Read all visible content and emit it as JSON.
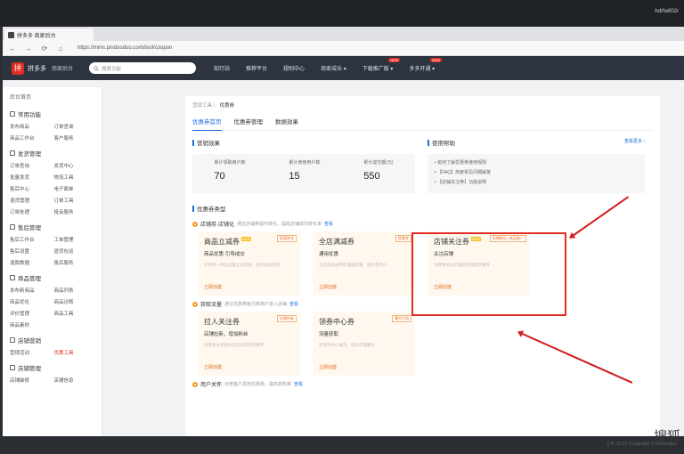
{
  "os": {
    "user_text": "hdrfw802r"
  },
  "browser": {
    "tab_title": "拼多多 商家后台",
    "url": "https://mms.pinduoduo.com/tool/coupon",
    "nav": [
      "←",
      "→",
      "⟳",
      "⌂"
    ]
  },
  "app": {
    "logo_char": "拼",
    "brand": "拼多多",
    "brand_sub": "商家后台",
    "search_placeholder": "搜索功能",
    "topnav": [
      {
        "label": "知行站",
        "badge": ""
      },
      {
        "label": "推荐平台",
        "badge": ""
      },
      {
        "label": "规则中心",
        "badge": ""
      },
      {
        "label": "商家成长 ▾",
        "badge": ""
      },
      {
        "label": "下载推广版 ▾",
        "badge": "NEW"
      },
      {
        "label": "多多开通 ▾",
        "badge": "NEW"
      }
    ]
  },
  "sidebar": {
    "home": "后台首页",
    "sections": [
      {
        "title": "常用功能",
        "links": [
          "发布商品",
          "订单查询",
          "商品工作台",
          "客户服务"
        ]
      },
      {
        "title": "发货管理",
        "links": [
          "订单查询",
          "发货中心",
          "批量发货",
          "物流工具",
          "售后中心",
          "电子面单",
          "退货管理",
          "订单工具",
          "订单处理",
          "投诉服务"
        ]
      },
      {
        "title": "售后管理",
        "links": [
          "售后工作台",
          "工单管理",
          "售后设置",
          "退货包运",
          "退款数据",
          "售后服务"
        ]
      },
      {
        "title": "商品管理",
        "links": [
          "发布新商品",
          "商品列表",
          "商品优化",
          "商品诊断",
          "评价管理",
          "商品工具",
          "商品素材"
        ]
      },
      {
        "title": "店铺营销",
        "links": [
          "营销活动",
          "优惠工具"
        ]
      },
      {
        "title": "店铺管理",
        "links": [
          "店铺装修",
          "店铺信息"
        ]
      }
    ]
  },
  "main": {
    "breadcrumb_root": "营销工具",
    "breadcrumb_current": "优惠券",
    "tabs": [
      "优惠券首页",
      "优惠券管理",
      "数据效果"
    ],
    "overview_title": "营销效果",
    "stats": [
      {
        "label": "累计领取用户数",
        "value": "70"
      },
      {
        "label": "累计使用用户数",
        "value": "15"
      },
      {
        "label": "累计成交额(元)",
        "value": "550"
      }
    ],
    "guide_title": "使用帮助",
    "guide_more": "查看更多 ›",
    "guide_items": [
      "• 如何了解优惠券使用规则",
      "• 【FAQ】商家常见问题解答",
      "• 【店铺关注券】功能说明"
    ],
    "types_title": "优惠券类型",
    "groups": [
      {
        "title": "店铺券·店铺化",
        "desc": "通过店铺券提升转化，提高店铺成交转化率",
        "link": "查看",
        "cards": [
          {
            "name": "商品立减券",
            "new": "NEW",
            "sub": "商品优惠·引导成交",
            "desc": "针对单一商品设置立减优惠，提升商品转化",
            "btn": "立即创建",
            "tag": "提高转化"
          },
          {
            "name": "全店满减券",
            "new": "",
            "sub": "通用优惠",
            "desc": "全店商品通用的满减优惠，提升客单价",
            "btn": "立即创建",
            "tag": "提客单"
          },
          {
            "name": "店铺关注券",
            "new": "NEW",
            "sub": "关注店铺",
            "desc": "消费者关注店铺即可领取优惠券",
            "btn": "立即创建",
            "tag": "店铺粉丝 | 新品推广"
          }
        ]
      },
      {
        "title": "获取流量",
        "desc": "通过优惠券吸引新用户进入店铺",
        "link": "查看",
        "cards": [
          {
            "name": "拉人关注券",
            "new": "",
            "sub": "店铺拉新，增加粉丝",
            "desc": "消费者分享给好友后可获得优惠券",
            "btn": "立即创建",
            "tag": "店铺拉新"
          },
          {
            "name": "领券中心券",
            "new": "",
            "sub": "流量获取",
            "desc": "在领券中心展示，提升店铺曝光",
            "btn": "立即创建",
            "tag": "曝光引流"
          }
        ]
      },
      {
        "title": "用户关怀",
        "desc": "对老客户发放优惠券，提高复购率",
        "link": "查看",
        "cards": []
      }
    ]
  },
  "footer": {
    "status": "上午 10:13 | Copyright © Pinduoduo"
  },
  "watermark": "搜狐"
}
